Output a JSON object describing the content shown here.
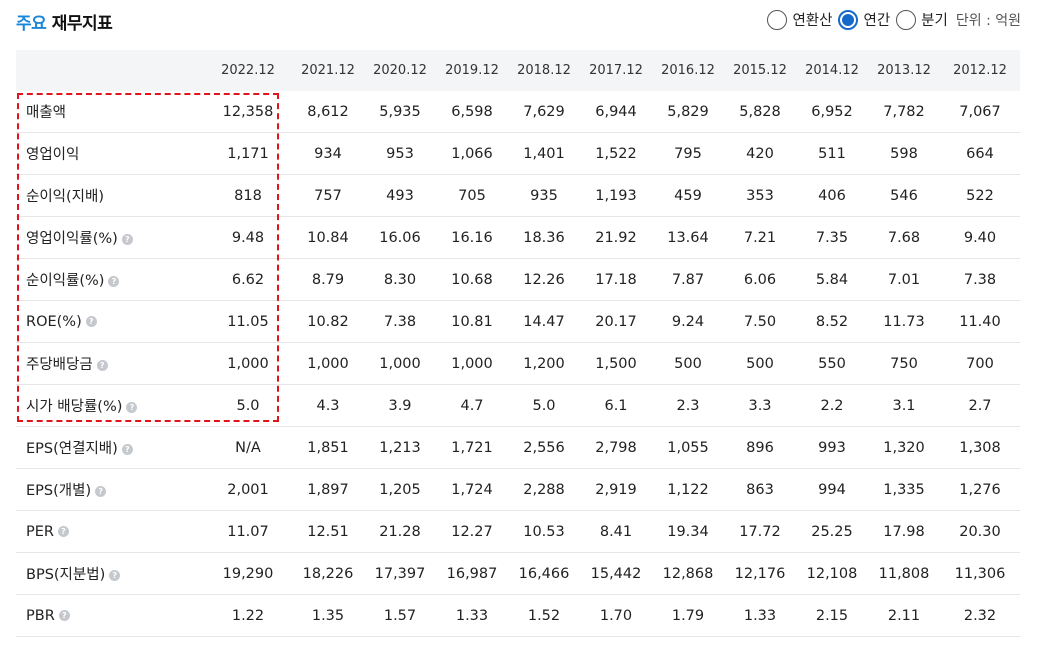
{
  "header": {
    "title_accent": "주요",
    "title_rest": "재무지표",
    "period_options": [
      {
        "label": "연환산",
        "selected": false
      },
      {
        "label": "연간",
        "selected": true
      },
      {
        "label": "분기",
        "selected": false
      }
    ],
    "unit_label": "단위 : 억원"
  },
  "table": {
    "columns": [
      "",
      "2022.12",
      "2021.12",
      "2020.12",
      "2019.12",
      "2018.12",
      "2017.12",
      "2016.12",
      "2015.12",
      "2014.12",
      "2013.12",
      "2012.12"
    ],
    "rows": [
      {
        "label": "매출액",
        "help": false,
        "values": [
          "12,358",
          "8,612",
          "5,935",
          "6,598",
          "7,629",
          "6,944",
          "5,829",
          "5,828",
          "6,952",
          "7,782",
          "7,067"
        ]
      },
      {
        "label": "영업이익",
        "help": false,
        "values": [
          "1,171",
          "934",
          "953",
          "1,066",
          "1,401",
          "1,522",
          "795",
          "420",
          "511",
          "598",
          "664"
        ]
      },
      {
        "label": "순이익(지배)",
        "help": false,
        "values": [
          "818",
          "757",
          "493",
          "705",
          "935",
          "1,193",
          "459",
          "353",
          "406",
          "546",
          "522"
        ]
      },
      {
        "label": "영업이익률(%)",
        "help": true,
        "values": [
          "9.48",
          "10.84",
          "16.06",
          "16.16",
          "18.36",
          "21.92",
          "13.64",
          "7.21",
          "7.35",
          "7.68",
          "9.40"
        ]
      },
      {
        "label": "순이익률(%)",
        "help": true,
        "values": [
          "6.62",
          "8.79",
          "8.30",
          "10.68",
          "12.26",
          "17.18",
          "7.87",
          "6.06",
          "5.84",
          "7.01",
          "7.38"
        ]
      },
      {
        "label": "ROE(%)",
        "help": true,
        "values": [
          "11.05",
          "10.82",
          "7.38",
          "10.81",
          "14.47",
          "20.17",
          "9.24",
          "7.50",
          "8.52",
          "11.73",
          "11.40"
        ]
      },
      {
        "label": "주당배당금",
        "help": true,
        "values": [
          "1,000",
          "1,000",
          "1,000",
          "1,000",
          "1,200",
          "1,500",
          "500",
          "500",
          "550",
          "750",
          "700"
        ]
      },
      {
        "label": "시가 배당률(%)",
        "help": true,
        "values": [
          "5.0",
          "4.3",
          "3.9",
          "4.7",
          "5.0",
          "6.1",
          "2.3",
          "3.3",
          "2.2",
          "3.1",
          "2.7"
        ]
      },
      {
        "label": "EPS(연결지배)",
        "help": true,
        "values": [
          "N/A",
          "1,851",
          "1,213",
          "1,721",
          "2,556",
          "2,798",
          "1,055",
          "896",
          "993",
          "1,320",
          "1,308"
        ]
      },
      {
        "label": "EPS(개별)",
        "help": true,
        "values": [
          "2,001",
          "1,897",
          "1,205",
          "1,724",
          "2,288",
          "2,919",
          "1,122",
          "863",
          "994",
          "1,335",
          "1,276"
        ]
      },
      {
        "label": "PER",
        "help": true,
        "values": [
          "11.07",
          "12.51",
          "21.28",
          "12.27",
          "10.53",
          "8.41",
          "19.34",
          "17.72",
          "25.25",
          "17.98",
          "20.30"
        ]
      },
      {
        "label": "BPS(지분법)",
        "help": true,
        "values": [
          "19,290",
          "18,226",
          "17,397",
          "16,987",
          "16,466",
          "15,442",
          "12,868",
          "12,176",
          "12,108",
          "11,808",
          "11,306"
        ]
      },
      {
        "label": "PBR",
        "help": true,
        "values": [
          "1.22",
          "1.35",
          "1.57",
          "1.33",
          "1.52",
          "1.70",
          "1.79",
          "1.33",
          "2.15",
          "2.11",
          "2.32"
        ]
      }
    ],
    "help_glyph": "?",
    "highlight_color": "#e0141a",
    "accent_color": "#1a86d8",
    "radio_color": "#1669c9"
  }
}
